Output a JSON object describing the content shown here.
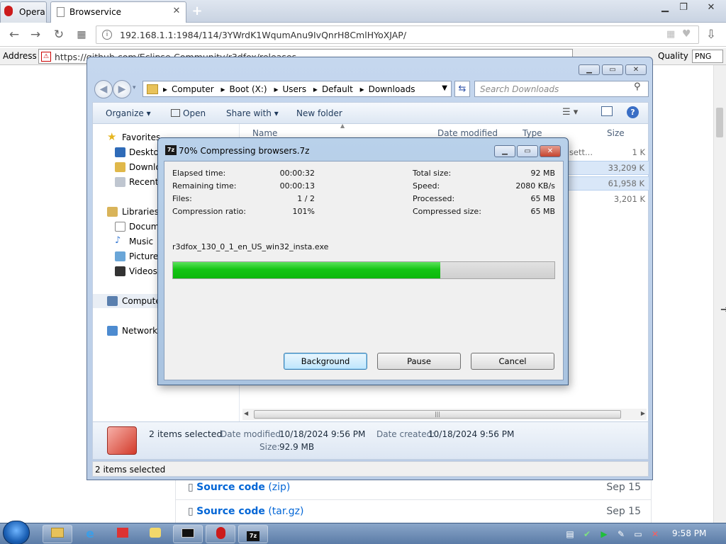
{
  "browser": {
    "tabs": [
      {
        "label": "Opera"
      },
      {
        "label": "Browservice"
      }
    ],
    "url": "192.168.1.1:1984/114/3YWrdK1WqumAnu9IvQnrH8CmlHYoXJAP/",
    "address_label": "Address",
    "address_value": "https://github.com/Eclipse-Community/r3dfox/releases",
    "quality_label": "Quality",
    "quality_value": "PNG"
  },
  "page_behind": {
    "assets": [
      {
        "label": "Source code",
        "suffix": "(zip)",
        "date": "Sep 15"
      },
      {
        "label": "Source code",
        "suffix": "(tar.gz)",
        "date": "Sep 15"
      }
    ]
  },
  "explorer": {
    "breadcrumb": [
      "Computer",
      "Boot (X:)",
      "Users",
      "Default",
      "Downloads"
    ],
    "search_placeholder": "Search Downloads",
    "toolbar": {
      "organize": "Organize ▾",
      "open": "Open",
      "share_with": "Share with ▾",
      "new_folder": "New folder"
    },
    "nav": {
      "favorites": "Favorites",
      "desktop": "Desktop",
      "downloads": "Downloads",
      "recent": "Recent Places",
      "libraries": "Libraries",
      "documents": "Documents",
      "music": "Music",
      "pictures": "Pictures",
      "videos": "Videos",
      "computer": "Computer",
      "network": "Network"
    },
    "columns": {
      "name": "Name",
      "date": "Date modified",
      "type": "Type",
      "size": "Size"
    },
    "rows": [
      {
        "type_partial": "n sett...",
        "size": "1 K"
      },
      {
        "type_partial": "",
        "size": "33,209 K"
      },
      {
        "type_partial": "",
        "size": "61,958 K"
      },
      {
        "type_partial": "",
        "size": "3,201 K"
      }
    ],
    "details": {
      "selection": "2 items selected",
      "date_modified_label": "Date modified:",
      "date_modified": "10/18/2024 9:56 PM",
      "date_created_label": "Date created:",
      "date_created": "10/18/2024 9:56 PM",
      "size_label": "Size:",
      "size": "92.9 MB"
    },
    "status": "2 items selected"
  },
  "dialog": {
    "icon_text": "7z",
    "title": "70% Compressing browsers.7z",
    "progress_fraction": 0.7,
    "stats_left": [
      {
        "label": "Elapsed time:",
        "value": "00:00:32"
      },
      {
        "label": "Remaining time:",
        "value": "00:00:13"
      },
      {
        "label": "Files:",
        "value": "1 / 2"
      },
      {
        "label": "Compression ratio:",
        "value": "101%"
      }
    ],
    "stats_right": [
      {
        "label": "Total size:",
        "value": "92 MB"
      },
      {
        "label": "Speed:",
        "value": "2080 KB/s"
      },
      {
        "label": "Processed:",
        "value": "65 MB"
      },
      {
        "label": "Compressed size:",
        "value": "65 MB"
      }
    ],
    "current_file": "r3dfox_130_0_1_en_US_win32_insta.exe",
    "buttons": {
      "background": "Background",
      "pause": "Pause",
      "cancel": "Cancel"
    }
  },
  "taskbar": {
    "clock": "9:58 PM",
    "tasks": [
      "explorer",
      "ie",
      "media",
      "paint",
      "cmd",
      "opera",
      "7z"
    ]
  },
  "colors": {
    "progress_fill": "#14c414",
    "link": "#0366d6",
    "opera_red": "#cc1b1b"
  }
}
